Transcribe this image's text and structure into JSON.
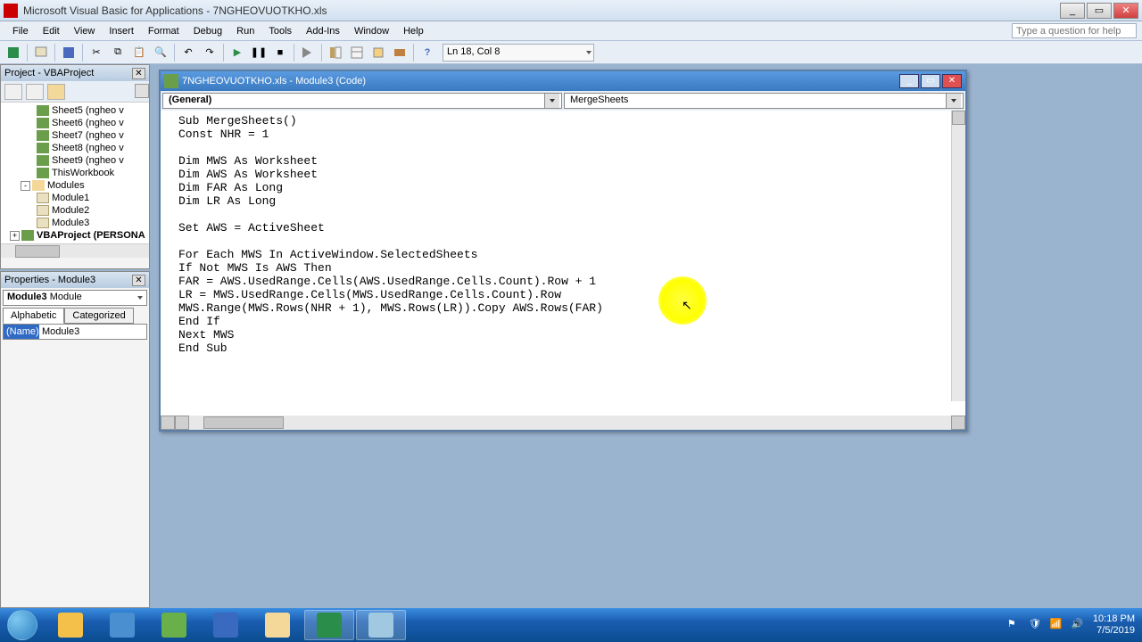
{
  "titlebar": {
    "title": "Microsoft Visual Basic for Applications - 7NGHEOVUOTKHO.xls"
  },
  "menubar": {
    "items": [
      "File",
      "Edit",
      "View",
      "Insert",
      "Format",
      "Debug",
      "Run",
      "Tools",
      "Add-Ins",
      "Window",
      "Help"
    ],
    "help_placeholder": "Type a question for help"
  },
  "toolbar": {
    "status": "Ln 18, Col 8"
  },
  "project_panel": {
    "title": "Project - VBAProject",
    "items": [
      {
        "indent": 36,
        "icon": "sheet",
        "label": "Sheet5 (ngheo v"
      },
      {
        "indent": 36,
        "icon": "sheet",
        "label": "Sheet6 (ngheo v"
      },
      {
        "indent": 36,
        "icon": "sheet",
        "label": "Sheet7 (ngheo v"
      },
      {
        "indent": 36,
        "icon": "sheet",
        "label": "Sheet8 (ngheo v"
      },
      {
        "indent": 36,
        "icon": "sheet",
        "label": "Sheet9 (ngheo v"
      },
      {
        "indent": 36,
        "icon": "sheet",
        "label": "ThisWorkbook"
      },
      {
        "indent": 18,
        "icon": "folder",
        "label": "Modules",
        "exp": "-"
      },
      {
        "indent": 36,
        "icon": "mod",
        "label": "Module1"
      },
      {
        "indent": 36,
        "icon": "mod",
        "label": "Module2"
      },
      {
        "indent": 36,
        "icon": "mod",
        "label": "Module3"
      },
      {
        "indent": 6,
        "icon": "proj",
        "label": "VBAProject (PERSONA",
        "exp": "+",
        "bold": true
      }
    ]
  },
  "props_panel": {
    "title": "Properties - Module3",
    "combo_name": "Module3",
    "combo_type": "Module",
    "tabs": [
      "Alphabetic",
      "Categorized"
    ],
    "rows": [
      {
        "name": "(Name)",
        "value": "Module3"
      }
    ]
  },
  "code_window": {
    "title": "7NGHEOVUOTKHO.xls - Module3 (Code)",
    "combo_left": "(General)",
    "combo_right": "MergeSheets",
    "code": "Sub MergeSheets()\nConst NHR = 1\n\nDim MWS As Worksheet\nDim AWS As Worksheet\nDim FAR As Long\nDim LR As Long\n\nSet AWS = ActiveSheet\n\nFor Each MWS In ActiveWindow.SelectedSheets\nIf Not MWS Is AWS Then\nFAR = AWS.UsedRange.Cells(AWS.UsedRange.Cells.Count).Row + 1\nLR = MWS.UsedRange.Cells(MWS.UsedRange.Cells.Count).Row\nMWS.Range(MWS.Rows(NHR + 1), MWS.Rows(LR)).Copy AWS.Rows(FAR)\nEnd If\nNext MWS\nEnd Sub"
  },
  "taskbar": {
    "items": [
      {
        "name": "chrome",
        "color": "#f4c04a"
      },
      {
        "name": "globe",
        "color": "#4a90d0"
      },
      {
        "name": "unikey",
        "color": "#6ab04a"
      },
      {
        "name": "word",
        "color": "#3a6ac0"
      },
      {
        "name": "explorer",
        "color": "#f4d89a"
      },
      {
        "name": "excel",
        "color": "#2a8e4a"
      },
      {
        "name": "notepad",
        "color": "#a0c8e0"
      }
    ],
    "clock_time": "10:18 PM",
    "clock_date": "7/5/2019"
  }
}
